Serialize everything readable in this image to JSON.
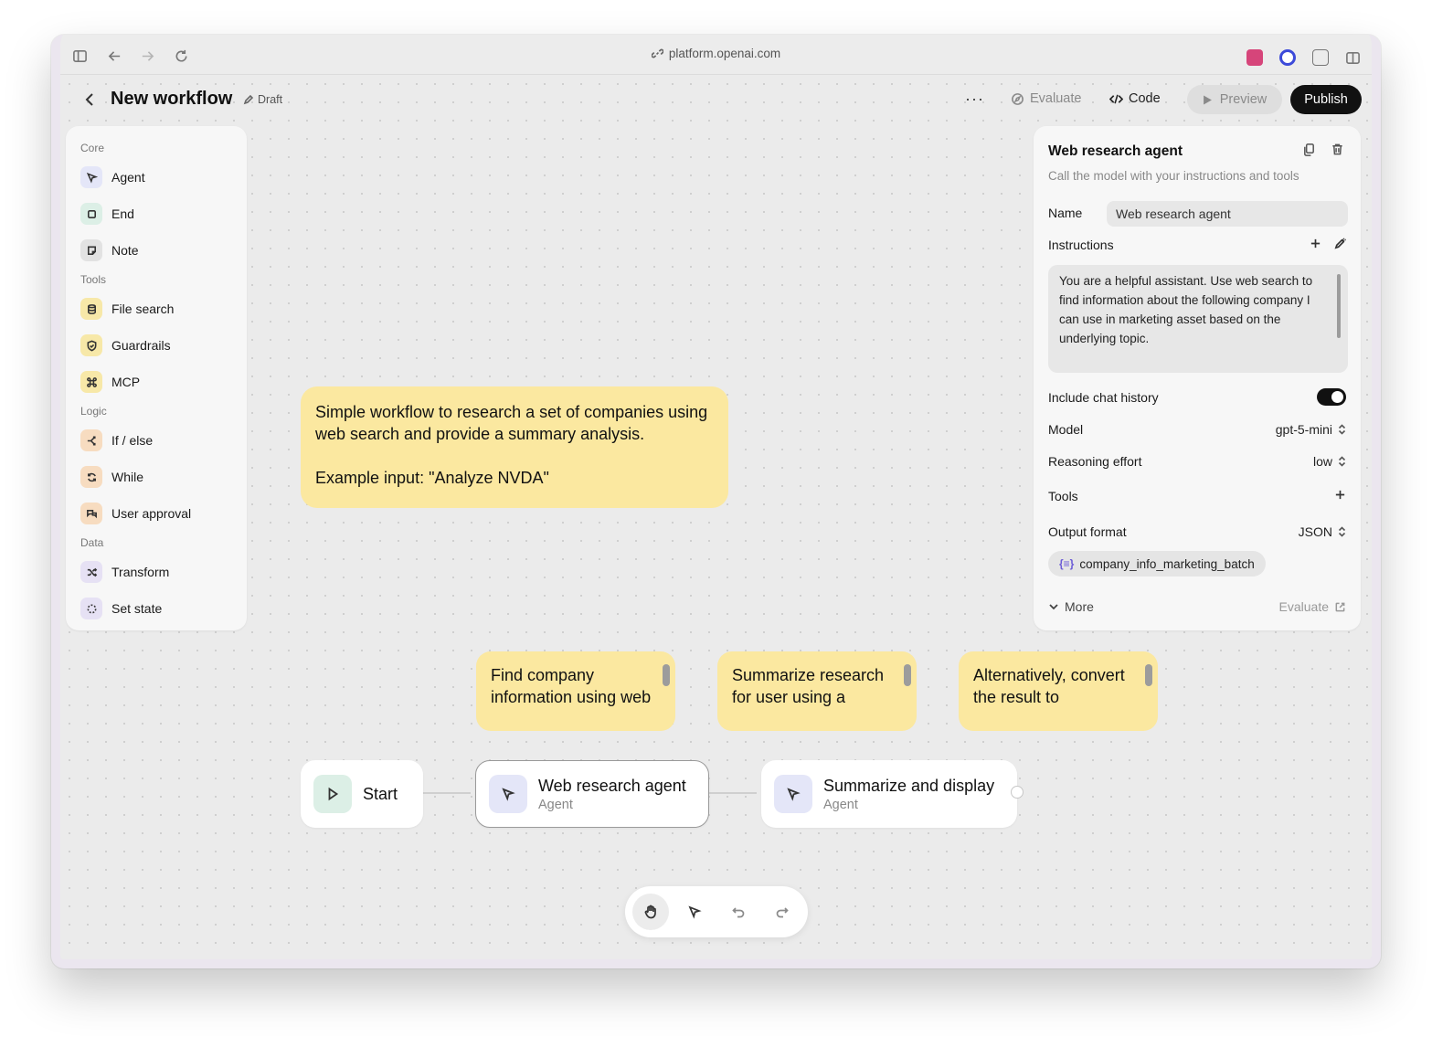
{
  "browser": {
    "url": "platform.openai.com"
  },
  "header": {
    "title": "New workflow",
    "status": "Draft",
    "more": "···",
    "evaluate_label": "Evaluate",
    "code_label": "Code",
    "preview_label": "Preview",
    "publish_label": "Publish"
  },
  "sidebar": {
    "sections": [
      {
        "title": "Core",
        "items": [
          {
            "label": "Agent",
            "icon": "agent-icon"
          },
          {
            "label": "End",
            "icon": "end-icon"
          },
          {
            "label": "Note",
            "icon": "note-icon"
          }
        ]
      },
      {
        "title": "Tools",
        "items": [
          {
            "label": "File search",
            "icon": "database-icon"
          },
          {
            "label": "Guardrails",
            "icon": "shield-icon"
          },
          {
            "label": "MCP",
            "icon": "command-icon"
          }
        ]
      },
      {
        "title": "Logic",
        "items": [
          {
            "label": "If / else",
            "icon": "branch-icon"
          },
          {
            "label": "While",
            "icon": "loop-icon"
          },
          {
            "label": "User approval",
            "icon": "approval-icon"
          }
        ]
      },
      {
        "title": "Data",
        "items": [
          {
            "label": "Transform",
            "icon": "shuffle-icon"
          },
          {
            "label": "Set state",
            "icon": "state-icon"
          }
        ]
      }
    ]
  },
  "canvas": {
    "main_note": {
      "line1": "Simple workflow to research a set of companies using web search and provide a summary analysis.",
      "line2": "Example input: \"Analyze NVDA\""
    },
    "small_notes": [
      "Find company information using web",
      "Summarize research for user using a",
      "Alternatively, convert the result to"
    ],
    "nodes": [
      {
        "title": "Start",
        "subtitle": ""
      },
      {
        "title": "Web research agent",
        "subtitle": "Agent"
      },
      {
        "title": "Summarize and display",
        "subtitle": "Agent"
      }
    ]
  },
  "panel": {
    "title": "Web research agent",
    "description": "Call the model with your instructions and tools",
    "name_label": "Name",
    "name_value": "Web research agent",
    "instructions_label": "Instructions",
    "instructions_text": "You are a helpful assistant. Use web search to find information about the following company I can use in marketing asset based on the underlying topic.",
    "chat_history_label": "Include chat history",
    "chat_history_on": true,
    "model_label": "Model",
    "model_value": "gpt-5-mini",
    "reasoning_label": "Reasoning effort",
    "reasoning_value": "low",
    "tools_label": "Tools",
    "output_label": "Output format",
    "output_value": "JSON",
    "schema_chip": "company_info_marketing_batch",
    "schema_icon_glyph": "{≡}",
    "more_label": "More",
    "evaluate_label": "Evaluate"
  },
  "colors": {
    "note_yellow": "#fbe8a0",
    "publish_bg": "#111111",
    "agent_icon_bg": "#e4e6f8",
    "start_icon_bg": "#dcefe6"
  }
}
